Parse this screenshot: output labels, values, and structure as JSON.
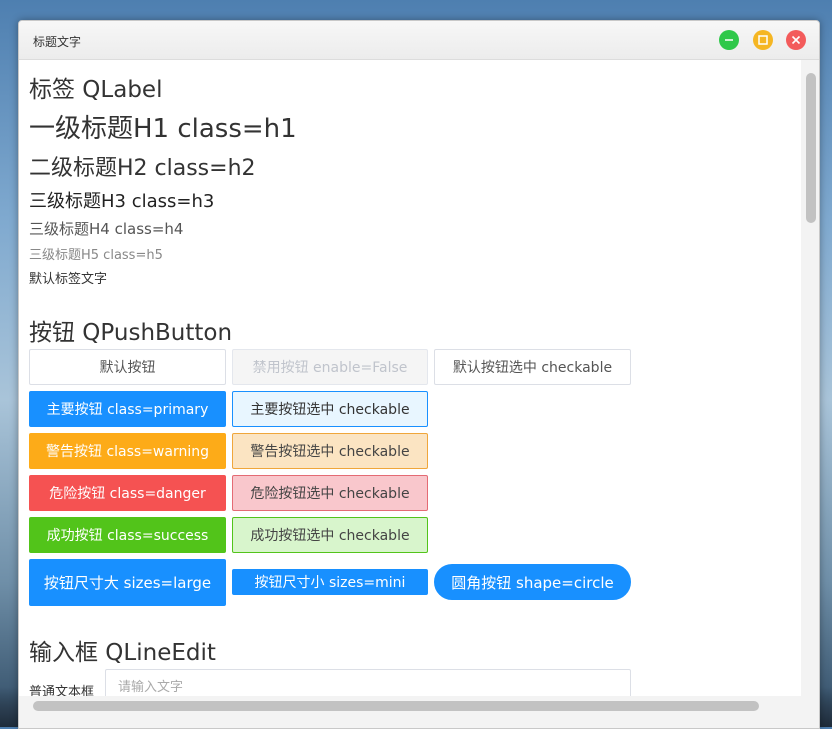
{
  "window": {
    "title": "标题文字"
  },
  "labels": {
    "section_title": "标签 QLabel",
    "h1": "一级标题H1  class=h1",
    "h2": "二级标题H2  class=h2",
    "h3": "三级标题H3  class=h3",
    "h4": "三级标题H4  class=h4",
    "h5": "三级标题H5  class=h5",
    "default": "默认标签文字"
  },
  "buttons": {
    "section_title": "按钮 QPushButton",
    "default": "默认按钮",
    "disabled": "禁用按钮 enable=False",
    "default_checkable": "默认按钮选中 checkable",
    "primary": "主要按钮 class=primary",
    "primary_checkable": "主要按钮选中 checkable",
    "warning": "警告按钮 class=warning",
    "warning_checkable": "警告按钮选中 checkable",
    "danger": "危险按钮 class=danger",
    "danger_checkable": "危险按钮选中  checkable",
    "success": "成功按钮 class=success",
    "success_checkable": "成功按钮选中 checkable",
    "large": "按钮尺寸大 sizes=large",
    "mini": "按钮尺寸小 sizes=mini",
    "circle": "圆角按钮 shape=circle"
  },
  "inputs": {
    "section_title": "输入框 QLineEdit",
    "normal_label": "普通文本框",
    "normal_placeholder": "请输入文字",
    "normal_value": ""
  },
  "colors": {
    "primary": "#1890ff",
    "warning": "#fdab18",
    "danger": "#f55252",
    "success": "#52c41a",
    "minimize": "#2fc84a",
    "maximize": "#f5b623",
    "close": "#f35b5b"
  },
  "icons": {
    "minimize": "minimize-icon",
    "maximize": "maximize-icon",
    "close": "close-icon"
  }
}
